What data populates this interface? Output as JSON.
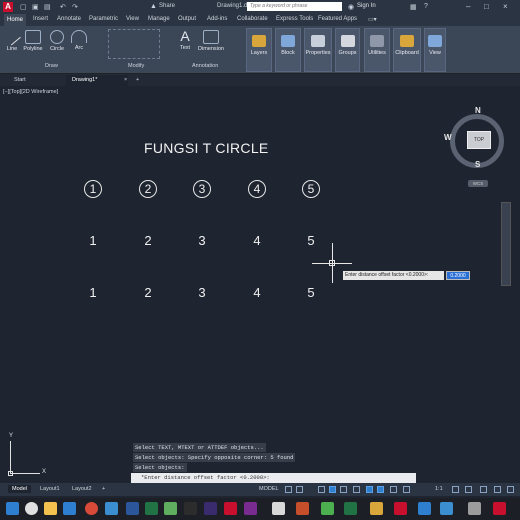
{
  "titlebar": {
    "logo": "A",
    "share": "Share",
    "doc_title": "Drawing1.dwg",
    "search_placeholder": "Type a keyword or phrase",
    "signin": "Sign In"
  },
  "ribbon_tabs": [
    "Home",
    "Insert",
    "Annotate",
    "Parametric",
    "View",
    "Manage",
    "Output",
    "Add-ins",
    "Collaborate",
    "Express Tools",
    "Featured Apps"
  ],
  "ribbon": {
    "draw_tools": [
      "Line",
      "Polyline",
      "Circle",
      "Arc"
    ],
    "draw_label": "Draw",
    "modify_label": "Modify",
    "annotation_tools": [
      "Text",
      "Dimension"
    ],
    "annotation_label": "Annotation",
    "big_buttons": [
      "Layers",
      "Block",
      "Properties",
      "Groups",
      "Utilities",
      "Clipboard",
      "View"
    ]
  },
  "file_tabs": [
    "Start",
    "Drawing1*"
  ],
  "viewport": {
    "label": "[−][Top][2D Wireframe]",
    "title": "FUNGSI T CIRCLE",
    "circled_numbers": [
      "1",
      "2",
      "3",
      "4",
      "5"
    ],
    "row2_numbers": [
      "1",
      "2",
      "3",
      "4",
      "5"
    ],
    "row3_numbers": [
      "1",
      "2",
      "3",
      "4",
      "5"
    ],
    "tooltip": "Enter distance offset factor <0.2000>:",
    "tooltip_value": "0.2000"
  },
  "viewcube": {
    "north": "N",
    "south": "S",
    "west": "W",
    "top": "TOP",
    "wcs": "WCS"
  },
  "ucs": {
    "x": "X",
    "y": "Y"
  },
  "command_history": [
    "Select TEXT, MTEXT or ATTDEF objects...",
    "Select objects: Specify opposite corner: 5 found",
    "Select objects:"
  ],
  "command_line": "*Enter distance offset factor <0.2000>:",
  "status_tabs": [
    "Model",
    "Layout1",
    "Layout2"
  ],
  "status": {
    "model": "MODEL",
    "scale": "1:1"
  },
  "colors": {
    "background": "#1e2430",
    "ribbon": "#3b4657",
    "accent": "#2f7fd0"
  }
}
